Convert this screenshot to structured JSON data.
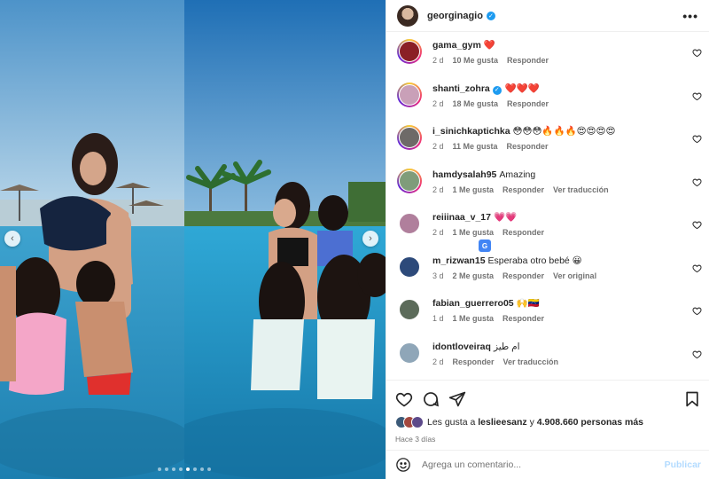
{
  "post": {
    "owner": "georginagio",
    "more_label": "•••"
  },
  "comments": [
    {
      "user": "gama_gym",
      "text": "❤️",
      "time": "2 d",
      "likes": "10 Me gusta",
      "reply": "Responder",
      "extra": "",
      "avatar_color": "#8a1f25",
      "ring": true
    },
    {
      "user": "shanti_zohra",
      "verified": true,
      "text": "❤️❤️❤️",
      "time": "2 d",
      "likes": "18 Me gusta",
      "reply": "Responder",
      "extra": "",
      "avatar_color": "#c9a0b8",
      "ring": true
    },
    {
      "user": "i_sinichkaptichka",
      "text": "😳😳😳🔥🔥🔥😍😍😍😍",
      "time": "2 d",
      "likes": "11 Me gusta",
      "reply": "Responder",
      "extra": "",
      "avatar_color": "#6e6a68",
      "ring": true
    },
    {
      "user": "hamdysalah95",
      "text": "Amazing",
      "time": "2 d",
      "likes": "1 Me gusta",
      "reply": "Responder",
      "extra": "Ver traducción",
      "avatar_color": "#7f9c7a",
      "ring": true
    },
    {
      "user": "reiiinaa_v_17",
      "text": "💗💗",
      "time": "2 d",
      "likes": "1 Me gusta",
      "reply": "Responder",
      "extra": "",
      "avatar_color": "#b07f9c",
      "ring": false
    },
    {
      "user": "m_rizwan15",
      "text": "Esperaba otro bebé 😀",
      "time": "3 d",
      "likes": "2 Me gusta",
      "reply": "Responder",
      "extra": "Ver original",
      "avatar_color": "#2d4a7a",
      "ring": false
    },
    {
      "user": "fabian_guerrero05",
      "text": "🙌🇻🇪",
      "time": "1 d",
      "likes": "1 Me gusta",
      "reply": "Responder",
      "extra": "",
      "avatar_color": "#5c6b5a",
      "ring": false
    },
    {
      "user": "idontloveiraq",
      "text": "ام طيز",
      "time": "2 d",
      "likes": "",
      "reply": "Responder",
      "extra": "Ver traducción",
      "avatar_color": "#8fa6b8",
      "ring": false
    }
  ],
  "translate_badge": "G",
  "likes": {
    "prefix": "Les gusta a",
    "user": "leslieesanz",
    "middle": "y",
    "count": "4.908.660 personas más"
  },
  "posted_ago": "Hace 3 días",
  "comment_box": {
    "placeholder": "Agrega un comentario...",
    "publish": "Publicar"
  },
  "carousel": {
    "slide_count": 8,
    "active_slide": 4
  },
  "colors": {
    "accent": "#0095f6",
    "verified": "#1d9bf0",
    "muted": "#737373"
  }
}
